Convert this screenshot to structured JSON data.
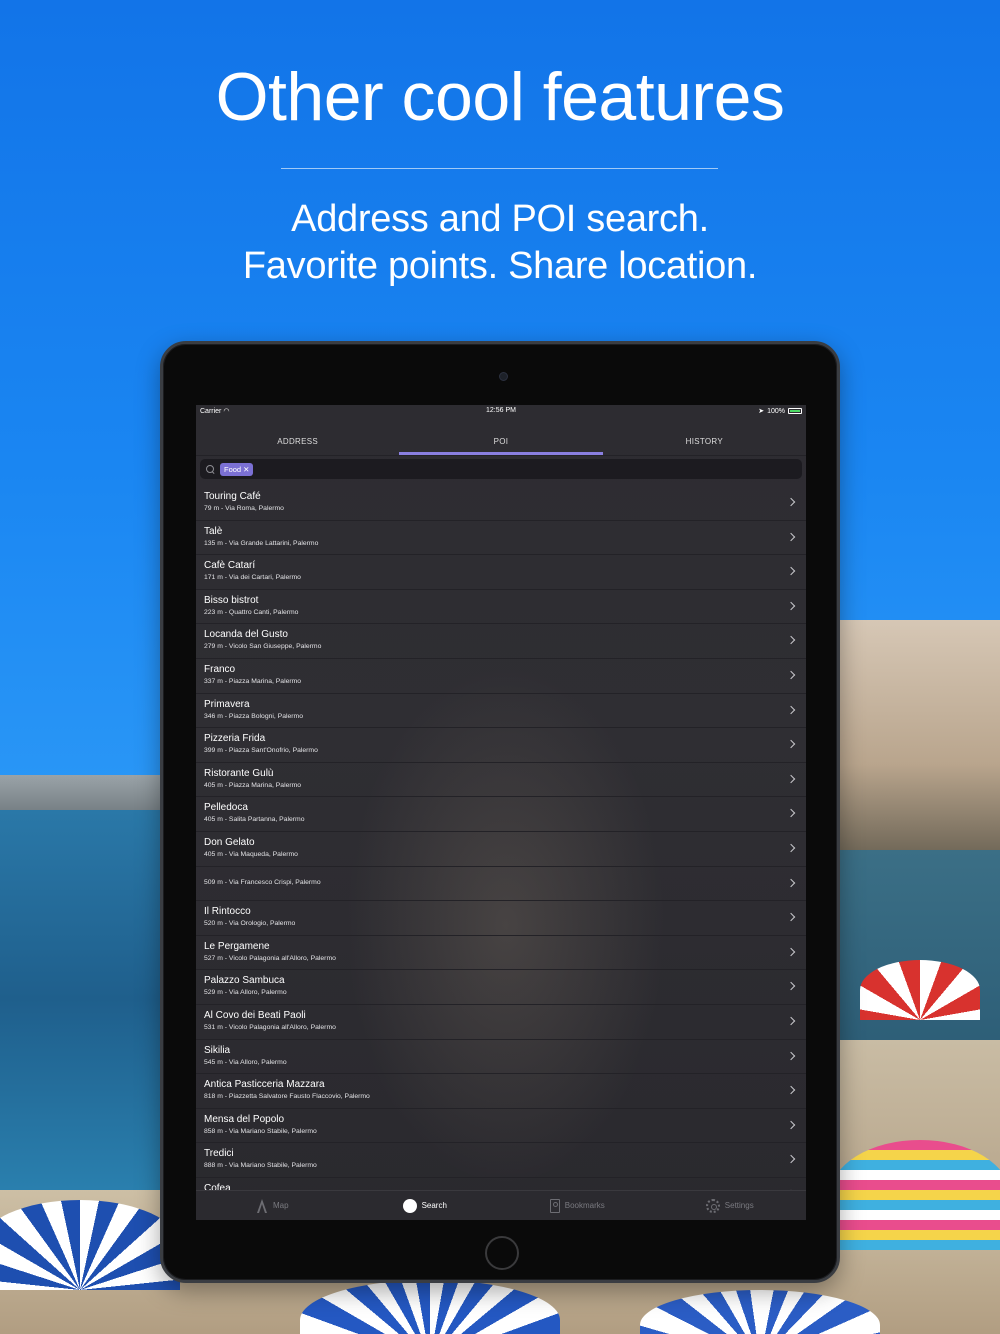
{
  "hero": {
    "title": "Other cool features",
    "subtitle_line1": "Address and POI search.",
    "subtitle_line2": "Favorite points. Share location."
  },
  "status_bar": {
    "carrier": "Carrier",
    "time": "12:56 PM",
    "battery": "100%"
  },
  "tabs": [
    {
      "label": "ADDRESS",
      "active": false
    },
    {
      "label": "POI",
      "active": true
    },
    {
      "label": "HISTORY",
      "active": false
    }
  ],
  "search": {
    "chip_label": "Food",
    "chip_remove": "✕"
  },
  "results": [
    {
      "title": "Touring Café",
      "subtitle": "79 m - Via Roma, Palermo"
    },
    {
      "title": "Talè",
      "subtitle": "135 m - Via Grande Lattarini, Palermo"
    },
    {
      "title": "Cafè Catarí",
      "subtitle": "171 m - Via dei Cartari, Palermo"
    },
    {
      "title": "Bisso bistrot",
      "subtitle": "223 m - Quattro Canti, Palermo"
    },
    {
      "title": "Locanda del Gusto",
      "subtitle": "279 m - Vicolo San Giuseppe, Palermo"
    },
    {
      "title": "Franco",
      "subtitle": "337 m - Piazza Marina, Palermo"
    },
    {
      "title": "Primavera",
      "subtitle": "346 m - Piazza Bologni, Palermo"
    },
    {
      "title": "Pizzeria Frida",
      "subtitle": "399 m - Piazza Sant'Onofrio, Palermo"
    },
    {
      "title": "Ristorante Gulù",
      "subtitle": "405 m - Piazza Marina, Palermo"
    },
    {
      "title": "Pelledoca",
      "subtitle": "405 m - Salita Partanna, Palermo"
    },
    {
      "title": "Don Gelato",
      "subtitle": "405 m - Via Maqueda, Palermo"
    },
    {
      "title": "",
      "subtitle": "509 m - Via Francesco Crispi, Palermo"
    },
    {
      "title": "Il Rintocco",
      "subtitle": "520 m - Via Orologio, Palermo"
    },
    {
      "title": "Le Pergamene",
      "subtitle": "527 m - Vicolo Palagonia all'Alloro, Palermo"
    },
    {
      "title": "Palazzo Sambuca",
      "subtitle": "529 m - Via Alloro, Palermo"
    },
    {
      "title": "Al Covo dei Beati Paoli",
      "subtitle": "531 m - Vicolo Palagonia all'Alloro, Palermo"
    },
    {
      "title": "Sikilia",
      "subtitle": "545 m - Via Alloro, Palermo"
    },
    {
      "title": "Antica Pasticceria Mazzara",
      "subtitle": "818 m - Piazzetta Salvatore Fausto Flaccovio, Palermo"
    },
    {
      "title": "Mensa del Popolo",
      "subtitle": "858 m - Via Mariano Stabile, Palermo"
    },
    {
      "title": "Tredici",
      "subtitle": "888 m - Via Mariano Stabile, Palermo"
    },
    {
      "title": "Cofea",
      "subtitle": ""
    }
  ],
  "bottom_nav": [
    {
      "label": "Map",
      "icon": "map-icon",
      "active": false
    },
    {
      "label": "Search",
      "icon": "search-icon",
      "active": true
    },
    {
      "label": "Bookmarks",
      "icon": "bookmarks-icon",
      "active": false
    },
    {
      "label": "Settings",
      "icon": "gear-icon",
      "active": false
    }
  ],
  "colors": {
    "accent": "#8a7fe0",
    "chip": "#7b70d4",
    "background_blue": "#1a86f2",
    "battery": "#4cd964"
  }
}
